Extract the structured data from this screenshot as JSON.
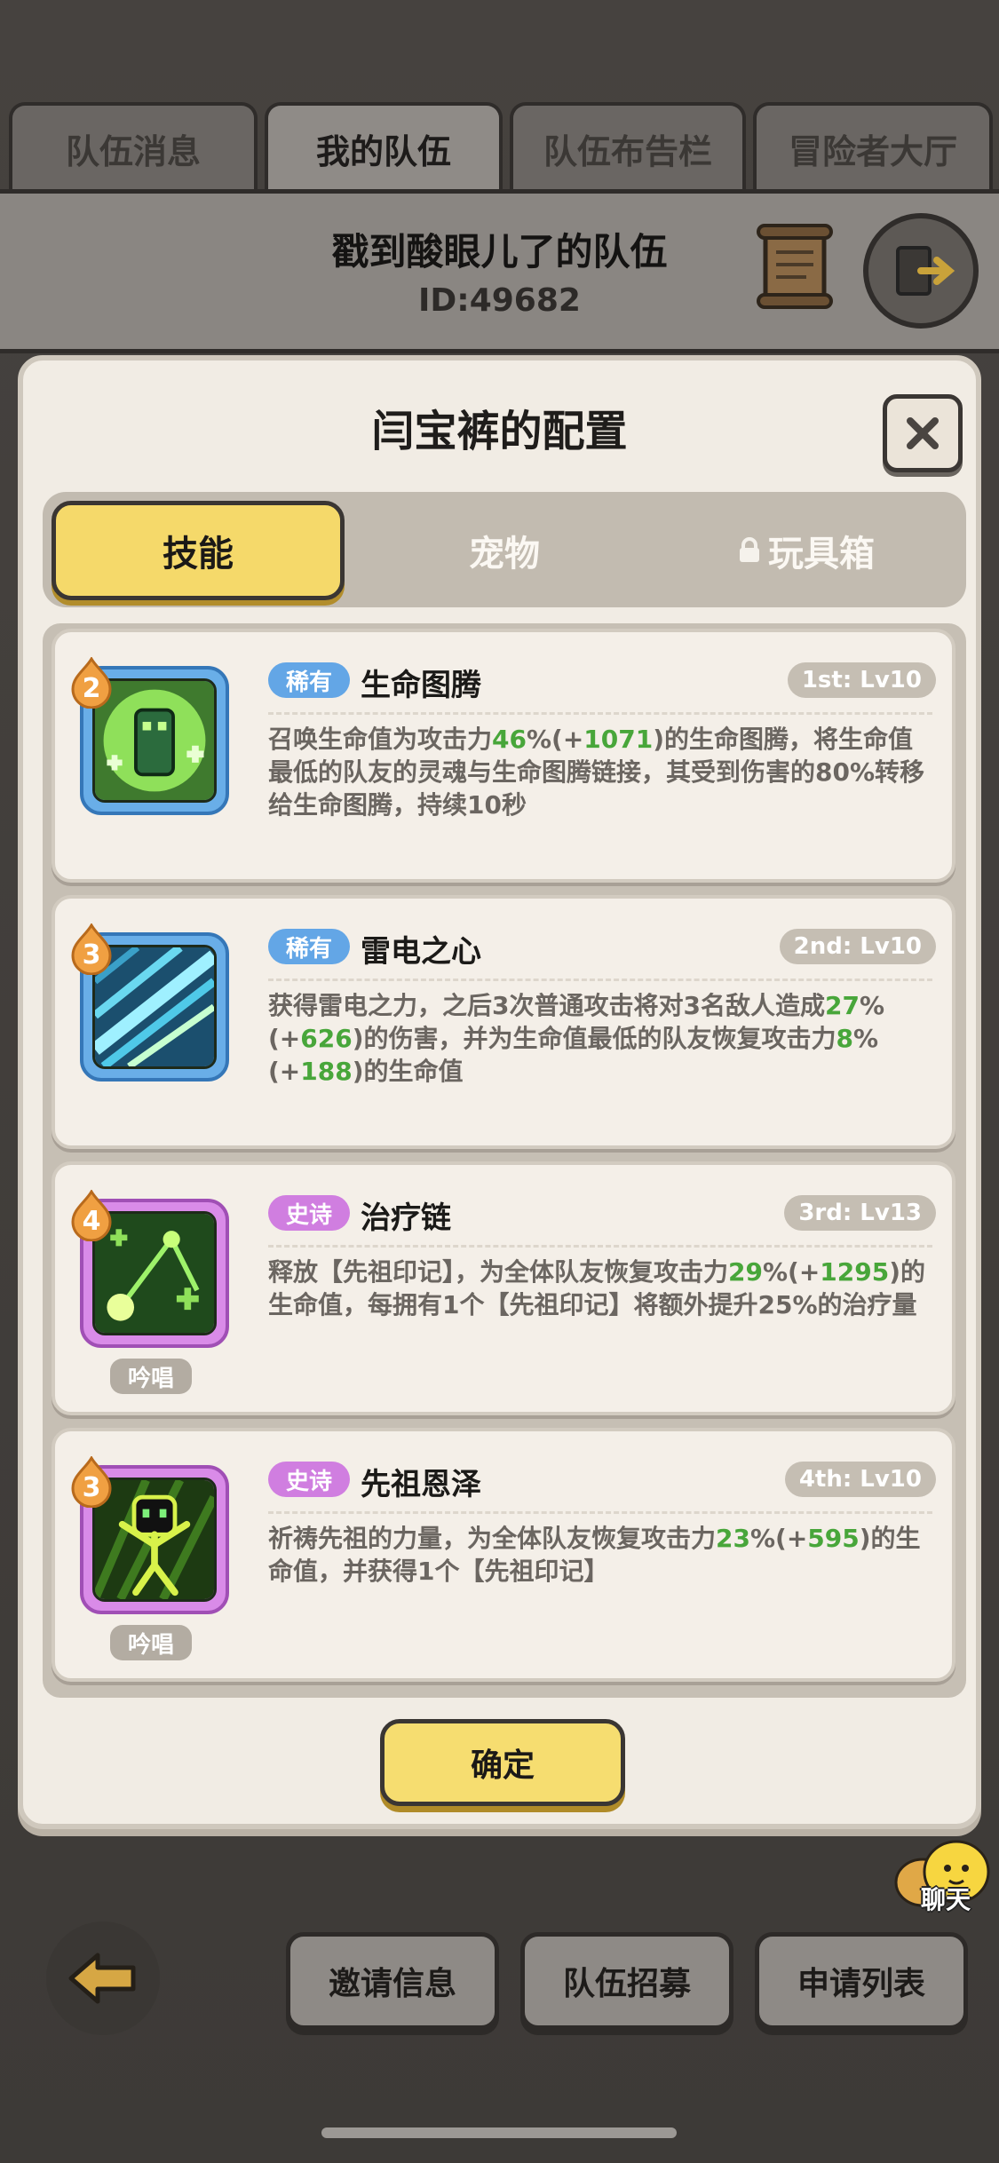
{
  "top_tabs": [
    "队伍消息",
    "我的队伍",
    "队伍布告栏",
    "冒险者大厅"
  ],
  "active_top_tab": 1,
  "team": {
    "name": "戳到酸眼儿了的队伍",
    "id": "ID:49682"
  },
  "modal": {
    "title": "闫宝裤的配置",
    "tabs": [
      "技能",
      "宠物",
      "玩具箱"
    ],
    "active_tab": 0,
    "skills": [
      {
        "level": "2",
        "rarity": "稀有",
        "rarity_kind": "rare",
        "name": "生命图腾",
        "slot": "1st: Lv10",
        "desc": [
          {
            "t": "召唤生命值为攻击力"
          },
          {
            "t": "46",
            "g": true
          },
          {
            "t": "%(+"
          },
          {
            "t": "1071",
            "g": true
          },
          {
            "t": ")的生命图腾，将生命值最低的队友的灵魂与生命图腾链接，其受到伤害的80%转移给生命图腾，持续10秒"
          }
        ],
        "icon": "totem-icon",
        "chant": ""
      },
      {
        "level": "3",
        "rarity": "稀有",
        "rarity_kind": "rare",
        "name": "雷电之心",
        "slot": "2nd: Lv10",
        "desc": [
          {
            "t": "获得雷电之力，之后3次普通攻击将对3名敌人造成"
          },
          {
            "t": "27",
            "g": true
          },
          {
            "t": "%(+"
          },
          {
            "t": "626",
            "g": true
          },
          {
            "t": ")的伤害，并为生命值最低的队友恢复攻击力"
          },
          {
            "t": "8",
            "g": true
          },
          {
            "t": "%(+"
          },
          {
            "t": "188",
            "g": true
          },
          {
            "t": ")的生命值"
          }
        ],
        "icon": "lightning-icon",
        "chant": ""
      },
      {
        "level": "4",
        "rarity": "史诗",
        "rarity_kind": "epic",
        "name": "治疗链",
        "slot": "3rd: Lv13",
        "desc": [
          {
            "t": "释放【先祖印记】，为全体队友恢复攻击力"
          },
          {
            "t": "29",
            "g": true
          },
          {
            "t": "%(+"
          },
          {
            "t": "1295",
            "g": true
          },
          {
            "t": ")的生命值，每拥有1个【先祖印记】将额外提升25%的治疗量"
          }
        ],
        "icon": "heal-chain-icon",
        "chant": "吟唱"
      },
      {
        "level": "3",
        "rarity": "史诗",
        "rarity_kind": "epic",
        "name": "先祖恩泽",
        "slot": "4th: Lv10",
        "desc": [
          {
            "t": "祈祷先祖的力量，为全体队友恢复攻击力"
          },
          {
            "t": "23",
            "g": true
          },
          {
            "t": "%(+"
          },
          {
            "t": "595",
            "g": true
          },
          {
            "t": ")的生命值，并获得1个【先祖印记】"
          }
        ],
        "icon": "ancestor-icon",
        "chant": "吟唱"
      }
    ],
    "confirm_label": "确定"
  },
  "chat_label": "聊天",
  "bottom_buttons": [
    "邀请信息",
    "队伍招募",
    "申请列表"
  ],
  "colors": {
    "accent_yellow": "#f6dd70",
    "value_green": "#48a63a",
    "rare_blue": "#63a6e6",
    "epic_purple": "#d07ee0"
  }
}
